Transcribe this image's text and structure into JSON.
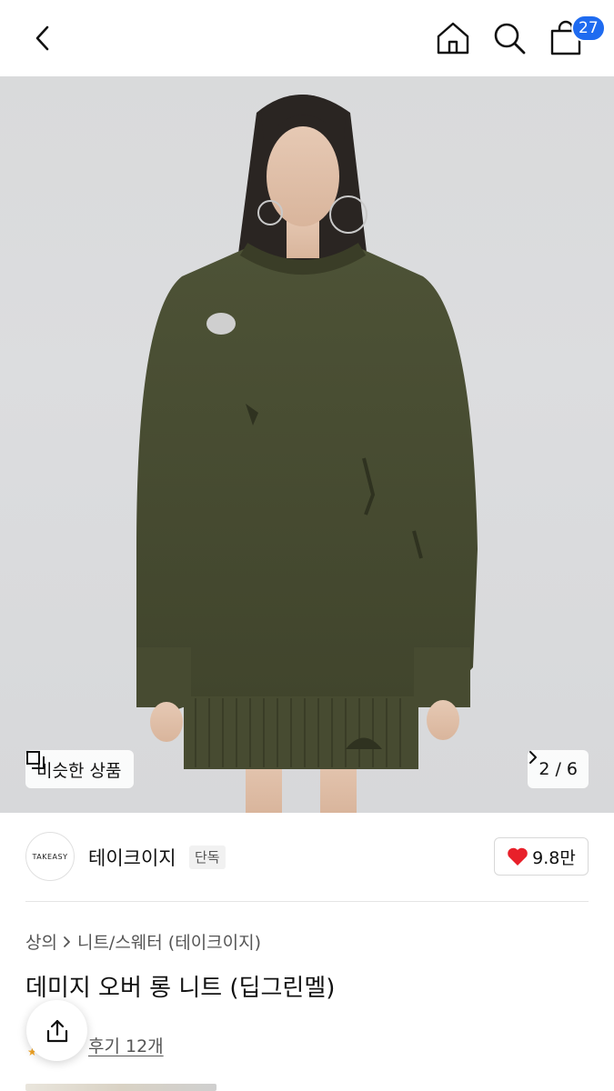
{
  "header": {
    "back_icon": "chevron-left-icon",
    "home_icon": "home-icon",
    "search_icon": "search-icon",
    "cart_icon": "shopping-bag-icon",
    "cart_count": "27",
    "badge_color": "#1f6bf0"
  },
  "gallery": {
    "similar_label": "비슷한 상품",
    "similar_icon": "copy-icon",
    "counter": "2 / 6",
    "counter_icon": "chevron-right-icon",
    "sweater_color": "#4a4e34"
  },
  "brand": {
    "logo_text": "TAKEASY",
    "name": "테이크이지",
    "tag": "단독",
    "likes": "9.8만",
    "heart_color": "#e8202a"
  },
  "product": {
    "breadcrumb": [
      "상의",
      "니트/스웨터 (테이크이지)"
    ],
    "title": "데미지 오버 롱 니트 (딥그린멜)",
    "review_label": "후기 12개"
  }
}
